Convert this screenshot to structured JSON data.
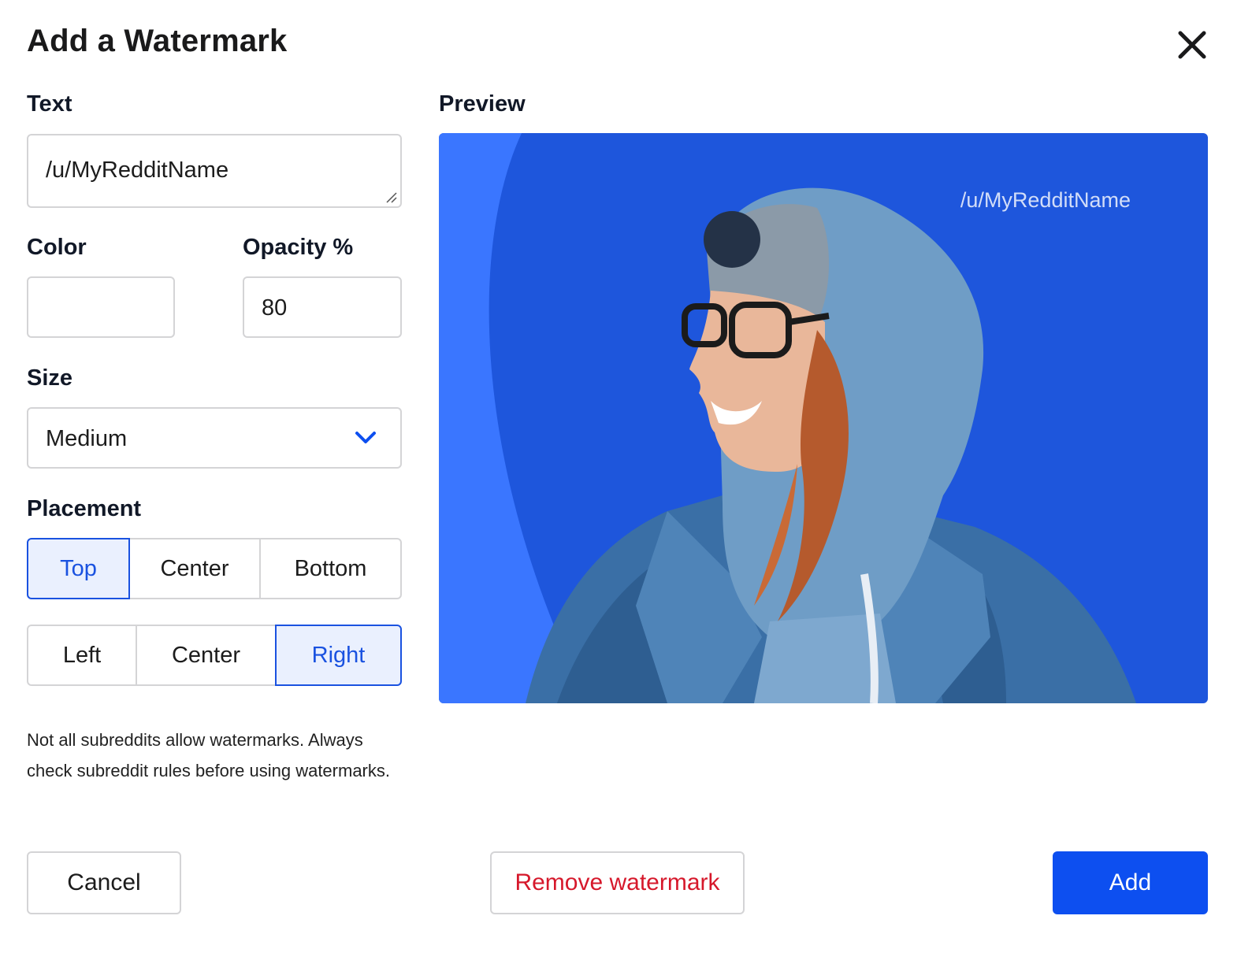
{
  "dialog": {
    "title": "Add a Watermark",
    "close_icon": "close-icon"
  },
  "text_field": {
    "label": "Text",
    "value": "/u/MyRedditName"
  },
  "color_field": {
    "label": "Color",
    "value": ""
  },
  "opacity_field": {
    "label": "Opacity %",
    "value": "80"
  },
  "size_field": {
    "label": "Size",
    "selected": "Medium",
    "icon": "chevron-down-icon"
  },
  "placement": {
    "label": "Placement",
    "vertical": [
      {
        "label": "Top",
        "active": true
      },
      {
        "label": "Center",
        "active": false
      },
      {
        "label": "Bottom",
        "active": false
      }
    ],
    "horizontal": [
      {
        "label": "Left",
        "active": false
      },
      {
        "label": "Center",
        "active": false
      },
      {
        "label": "Right",
        "active": true
      }
    ]
  },
  "note": "Not all subreddits allow watermarks. Always check subreddit rules before using watermarks.",
  "preview": {
    "label": "Preview",
    "watermark_text": "/u/MyRedditName",
    "watermark_opacity": 0.8
  },
  "buttons": {
    "cancel": "Cancel",
    "remove": "Remove watermark",
    "add": "Add"
  },
  "colors": {
    "accent": "#0d4ff0",
    "danger": "#d6182b",
    "preview_bg": "#1e56dc",
    "active_bg": "#eaf0fe"
  }
}
